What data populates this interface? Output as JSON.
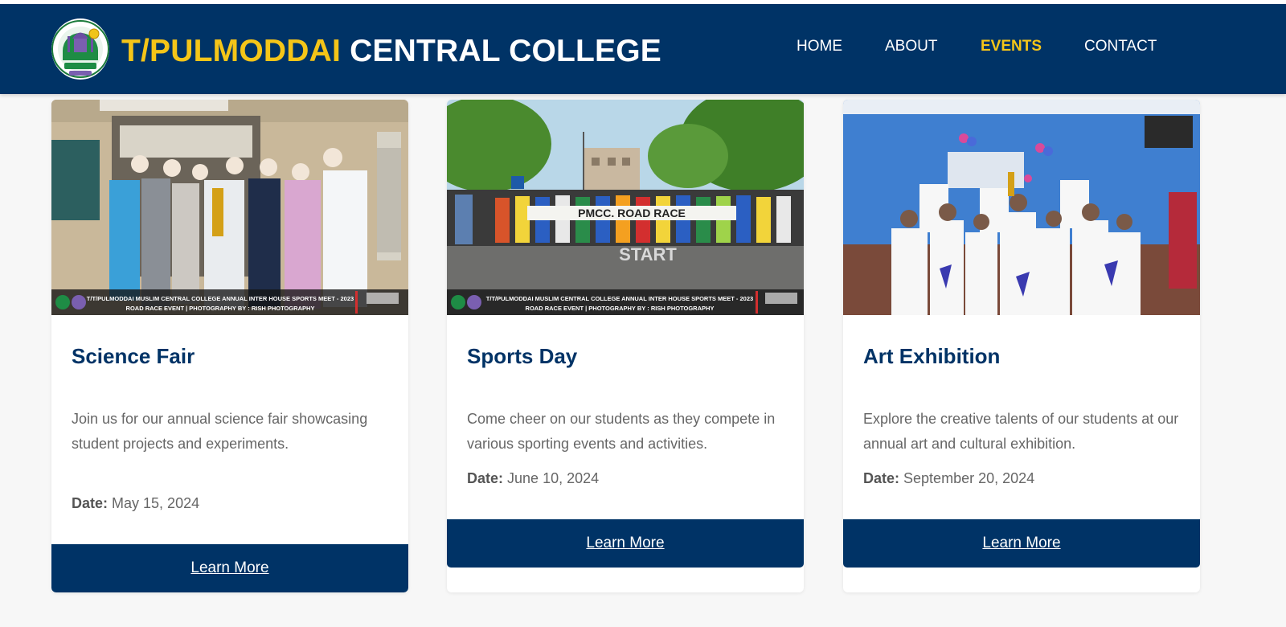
{
  "header": {
    "brand_highlight": "T/PULMODDAI",
    "brand_rest": "CENTRAL COLLEGE",
    "logo_icon": "college-crest-icon",
    "accent_color": "#f5c518",
    "bg_color": "#003366"
  },
  "nav": {
    "items": [
      {
        "label": "HOME"
      },
      {
        "label": "ABOUT"
      },
      {
        "label": "EVENTS",
        "active": true
      },
      {
        "label": "CONTACT"
      }
    ]
  },
  "events": [
    {
      "title": "Science Fair",
      "description": "Join us for our annual science fair showcasing student projects and experiments.",
      "date_label": "Date:",
      "date": "May 15, 2024",
      "button": "Learn More",
      "image_caption_1": "T/T/PULMODDAI MUSLIM CENTRAL COLLEGE ANNUAL INTER HOUSE SPORTS MEET - 2023",
      "image_caption_2": "ROAD RACE EVENT | PHOTOGRAPHY BY : RISH PHOTOGRAPHY"
    },
    {
      "title": "Sports Day",
      "description": "Come cheer on our students as they compete in various sporting events and activities.",
      "date_label": "Date:",
      "date": "June 10, 2024",
      "button": "Learn More",
      "image_caption_1": "T/T/PULMODDAI MUSLIM CENTRAL COLLEGE ANNUAL INTER HOUSE SPORTS MEET - 2023",
      "image_caption_2": "ROAD RACE EVENT | PHOTOGRAPHY BY : RISH PHOTOGRAPHY",
      "banner_text": "PMCC. ROAD RACE",
      "road_text": "START"
    },
    {
      "title": "Art Exhibition",
      "description": "Explore the creative talents of our students at our annual art and cultural exhibition.",
      "date_label": "Date:",
      "date": "September 20, 2024",
      "button": "Learn More"
    }
  ]
}
